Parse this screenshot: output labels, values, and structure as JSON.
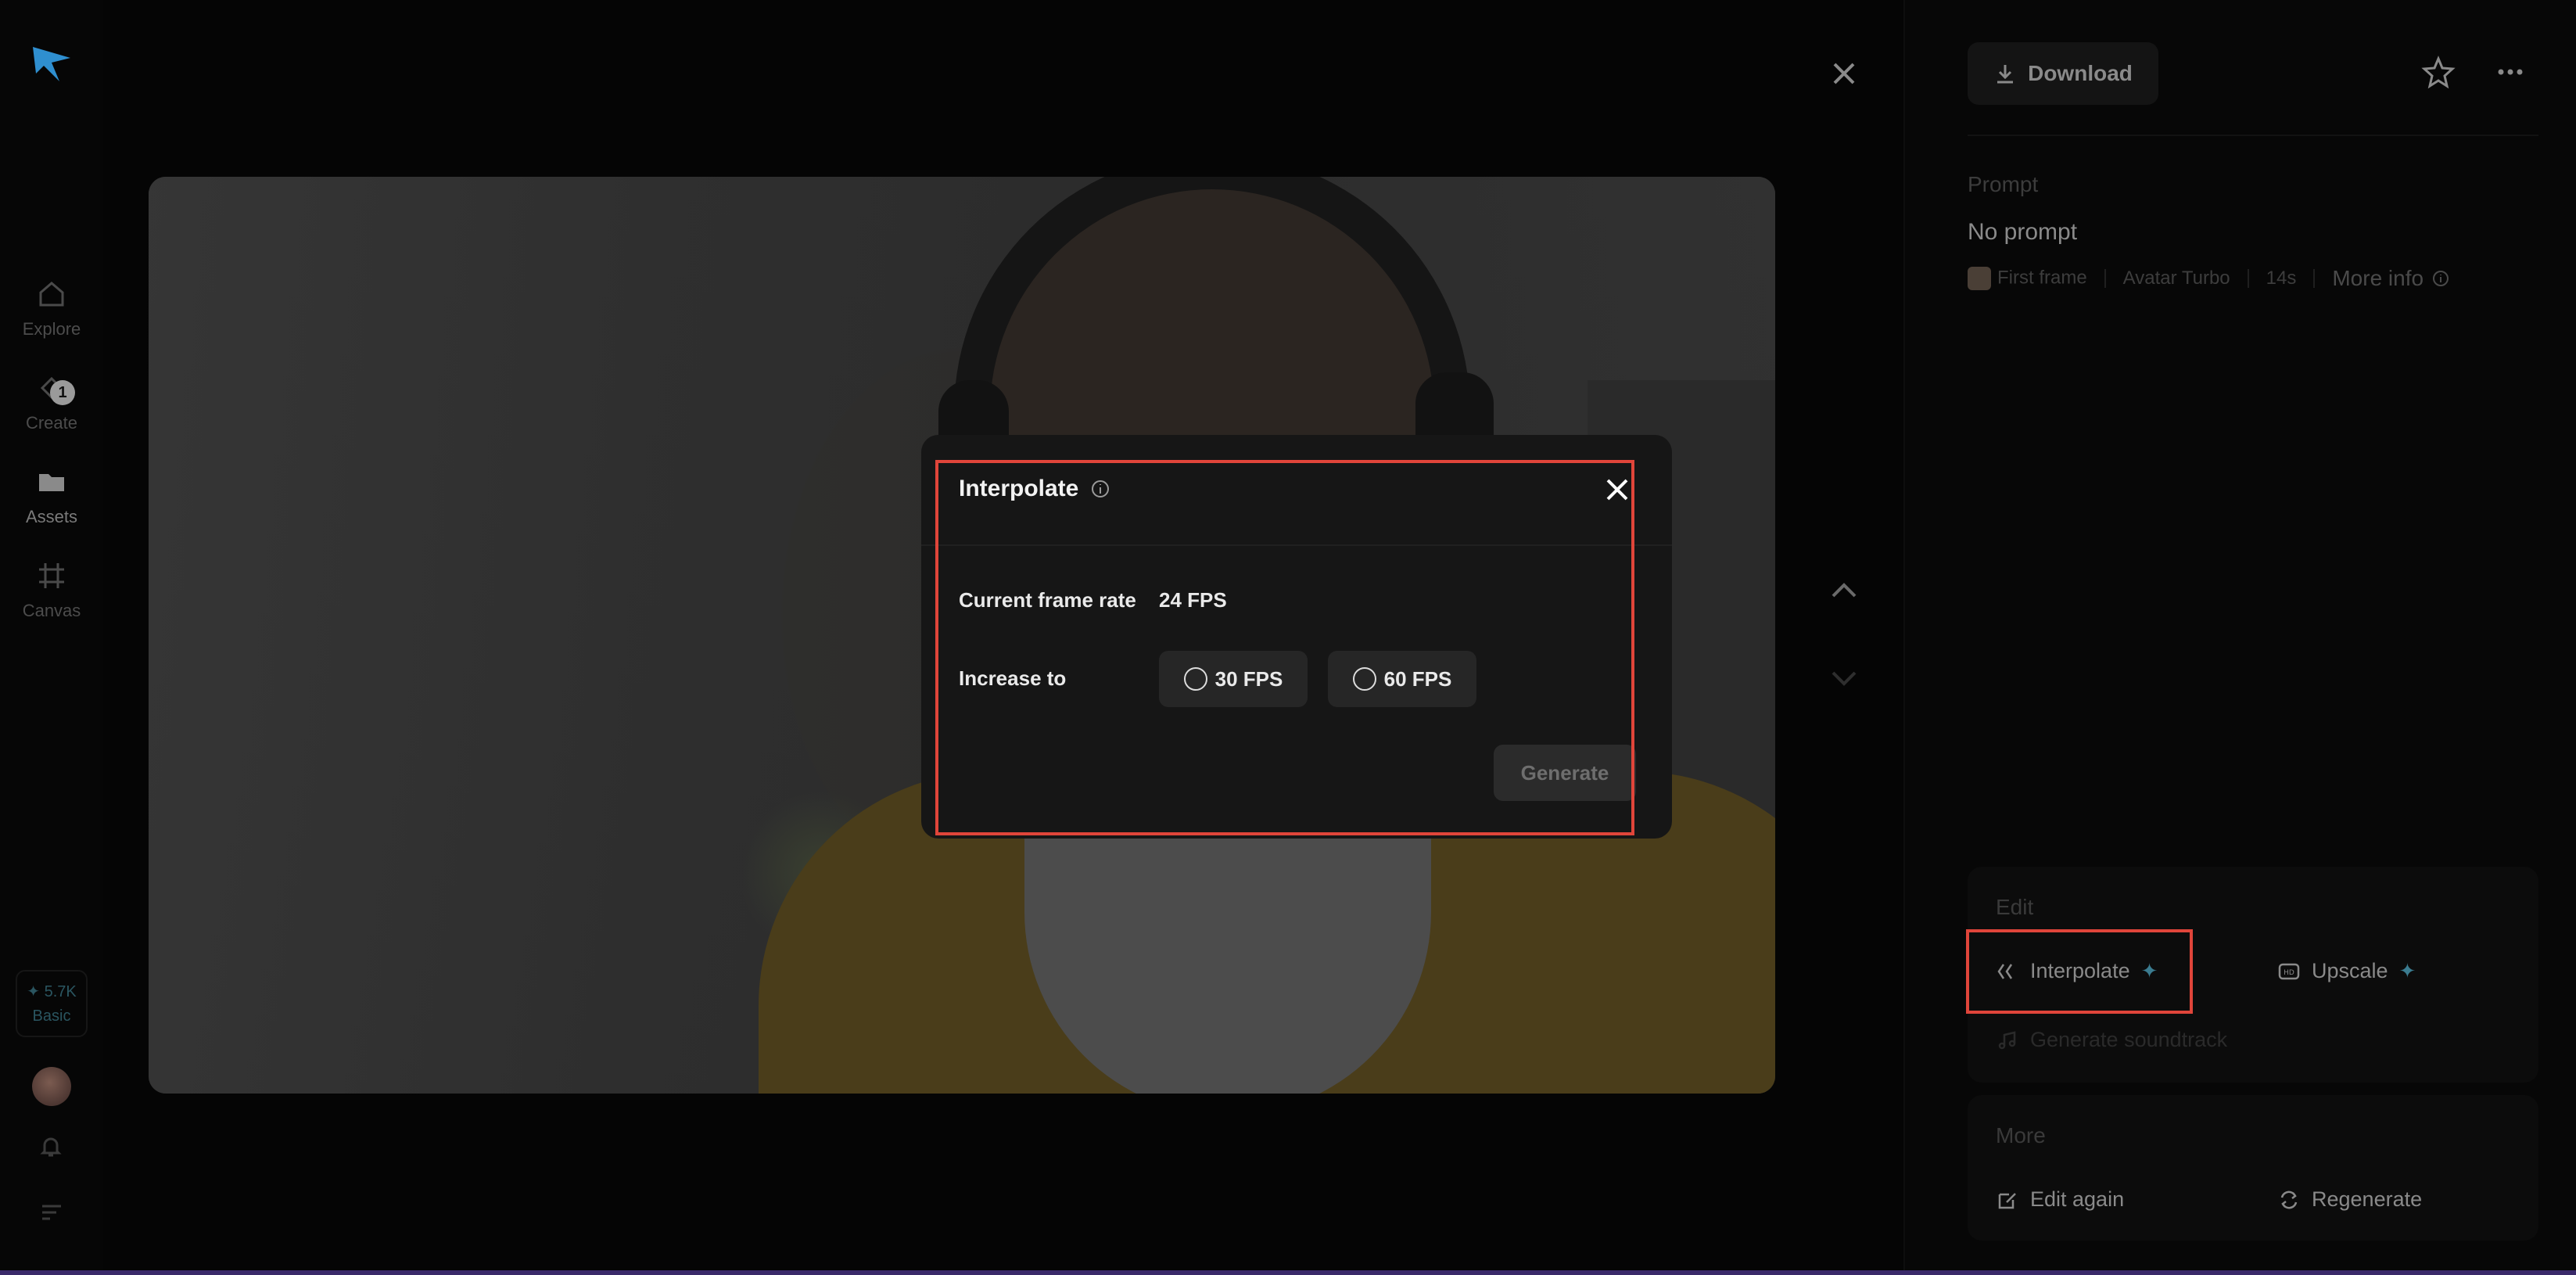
{
  "nav": {
    "items": [
      {
        "label": "Explore",
        "icon": "home-icon"
      },
      {
        "label": "Create",
        "icon": "create-icon",
        "badge": "1"
      },
      {
        "label": "Assets",
        "icon": "folder-icon"
      },
      {
        "label": "Canvas",
        "icon": "canvas-icon"
      }
    ],
    "credits_amount": "✦ 5.7K",
    "plan": "Basic"
  },
  "right_panel": {
    "download_label": "Download",
    "prompt_label": "Prompt",
    "prompt_value": "No prompt",
    "meta": {
      "first_frame": "First frame",
      "model": "Avatar Turbo",
      "duration": "14s",
      "more_info": "More info"
    },
    "edit": {
      "title": "Edit",
      "interpolate": "Interpolate",
      "upscale": "Upscale",
      "soundtrack": "Generate soundtrack"
    },
    "more": {
      "title": "More",
      "edit_again": "Edit again",
      "regenerate": "Regenerate"
    }
  },
  "modal": {
    "title": "Interpolate",
    "current_frame_rate_label": "Current frame rate",
    "current_frame_rate_value": "24 FPS",
    "increase_to_label": "Increase to",
    "options": [
      "30 FPS",
      "60 FPS"
    ],
    "generate_label": "Generate"
  },
  "colors": {
    "accent_teal": "#3b7c90",
    "highlight": "#e0453a",
    "logo_blue": "#2f8fd0"
  }
}
